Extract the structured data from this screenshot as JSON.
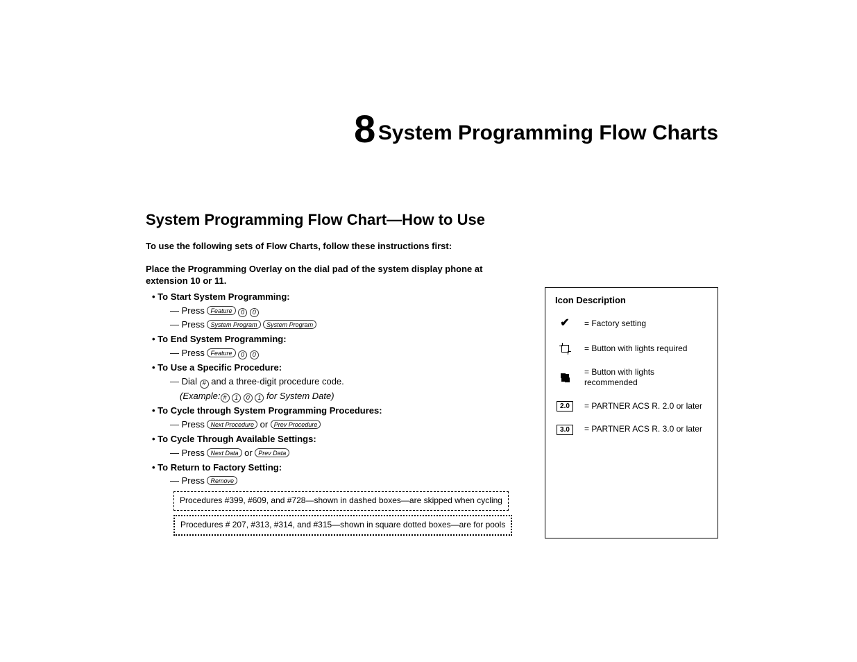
{
  "chapter": {
    "number": "8",
    "title": "System Programming Flow Charts"
  },
  "section_title": "System Programming Flow Chart—How to Use",
  "intro": "To use the following sets of Flow Charts, follow these instructions first:",
  "subintro": "Place the Programming Overlay on the dial pad of the system display phone at extension 10 or 11.",
  "items": [
    {
      "head": "To Start System Programming:",
      "subs": [
        {
          "pre": "Press ",
          "keys": [
            {
              "t": "btn",
              "l": "Feature"
            },
            {
              "t": "circ",
              "l": "0"
            },
            {
              "t": "circ",
              "l": "0"
            }
          ]
        },
        {
          "pre": "Press ",
          "keys": [
            {
              "t": "btn",
              "l": "System Program"
            },
            {
              "t": "btn",
              "l": "System Program"
            }
          ]
        }
      ]
    },
    {
      "head": "To End System Programming:",
      "subs": [
        {
          "pre": "Press ",
          "keys": [
            {
              "t": "btn",
              "l": "Feature"
            },
            {
              "t": "circ",
              "l": "0"
            },
            {
              "t": "circ",
              "l": "0"
            }
          ]
        }
      ]
    },
    {
      "head": "To Use a Specific Procedure:",
      "subs": [
        {
          "pre": "Dial ",
          "keys": [
            {
              "t": "circ",
              "l": "#"
            }
          ],
          "post": " and a three-digit procedure code."
        },
        {
          "italic_pre": "(Example:",
          "italic_keys": [
            {
              "t": "circ",
              "l": "#"
            },
            {
              "t": "circ",
              "l": "1"
            },
            {
              "t": "circ",
              "l": "0"
            },
            {
              "t": "circ",
              "l": "1"
            }
          ],
          "italic_post": " for System Date)"
        }
      ]
    },
    {
      "head": "To Cycle through System Programming Procedures:",
      "subs": [
        {
          "pre": "Press ",
          "keys": [
            {
              "t": "btn",
              "l": "Next Procedure"
            }
          ],
          "mid": " or ",
          "keys2": [
            {
              "t": "btn",
              "l": "Prev Procedure"
            }
          ]
        }
      ]
    },
    {
      "head": "To Cycle Through Available Settings:",
      "subs": [
        {
          "pre": "Press ",
          "keys": [
            {
              "t": "btn",
              "l": "Next Data"
            }
          ],
          "mid": " or ",
          "keys2": [
            {
              "t": "btn",
              "l": "Prev Data"
            }
          ]
        }
      ]
    },
    {
      "head": "To Return to Factory Setting:",
      "subs": [
        {
          "pre": "Press ",
          "keys": [
            {
              "t": "btn",
              "l": "Remove"
            }
          ]
        }
      ]
    }
  ],
  "note_dashed": "Procedures #399, #609, and #728—shown in dashed boxes—are skipped when cycling",
  "note_dotted": "Procedures # 207, #313, #314, and #315—shown in square dotted boxes—are for pools",
  "legend": {
    "title": "Icon Description",
    "rows": [
      {
        "icon": "check",
        "text": "= Factory setting"
      },
      {
        "icon": "sq-open",
        "text": "= Button with lights required"
      },
      {
        "icon": "sq-fill",
        "text": "= Button with lights recommended"
      },
      {
        "icon": "vbox",
        "label": "2.0",
        "text": "= PARTNER ACS R. 2.0 or later"
      },
      {
        "icon": "vbox",
        "label": "3.0",
        "text": "= PARTNER ACS R. 3.0 or later"
      }
    ]
  }
}
